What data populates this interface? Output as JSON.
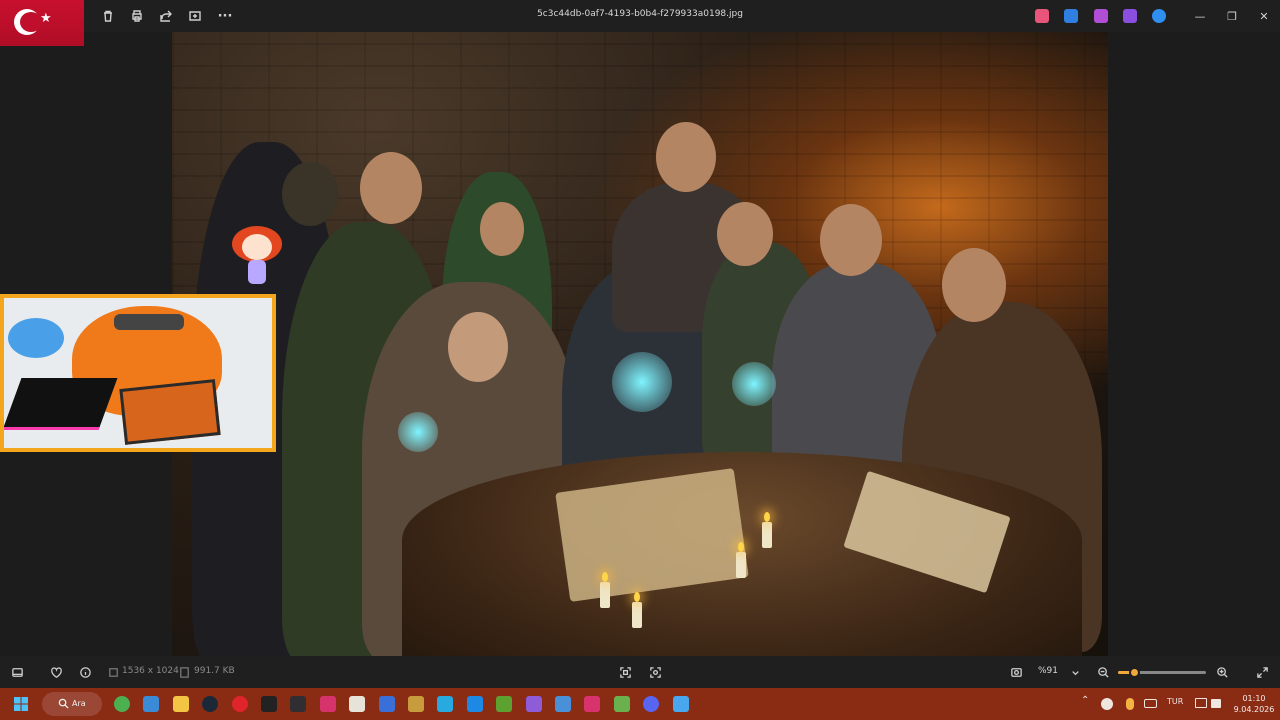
{
  "titlebar": {
    "filename": "5c3c44db-0af7-4193-b0b4-f279933a0198.jpg",
    "actions": [
      "delete-icon",
      "print-icon",
      "share-icon",
      "edit-icon",
      "more-icon"
    ],
    "more_glyph": "···",
    "app_icons": [
      {
        "name": "copilot-icon",
        "color": "#e9557a"
      },
      {
        "name": "designer-icon",
        "color": "#2f7fe0"
      },
      {
        "name": "paint-icon",
        "color": "#b04fd6"
      },
      {
        "name": "clipchamp-icon",
        "color": "#8a4ee0"
      },
      {
        "name": "onedrive-icon",
        "color": "#2f8ff0"
      }
    ],
    "minimize_glyph": "—",
    "maximize_glyph": "❐",
    "close_glyph": "✕"
  },
  "flag": {
    "star": "★"
  },
  "bottombar": {
    "dimensions": "1536 x 1024",
    "filesize": "991.7 KB",
    "zoom": "%91",
    "zoom_level": 0.18
  },
  "taskbar": {
    "search_label": "Ara",
    "language": "TUR",
    "time": "01:10",
    "date": "9.04.2026",
    "apps": [
      {
        "name": "xbox-icon",
        "color": "#4caf50"
      },
      {
        "name": "task-view-icon",
        "color": "#3a8ad6"
      },
      {
        "name": "file-explorer-icon",
        "color": "#f4c542"
      },
      {
        "name": "steam-icon",
        "color": "#1b2838"
      },
      {
        "name": "opera-icon",
        "color": "#e0242e"
      },
      {
        "name": "epic-games-icon",
        "color": "#222222"
      },
      {
        "name": "obs-icon",
        "color": "#302e31"
      },
      {
        "name": "instagram-icon",
        "color": "#d6336c"
      },
      {
        "name": "paint-net-icon",
        "color": "#e8e3d8"
      },
      {
        "name": "drawing-icon",
        "color": "#3b6fd8"
      },
      {
        "name": "league-icon",
        "color": "#c89b3c"
      },
      {
        "name": "app-blue-icon",
        "color": "#28a9e0"
      },
      {
        "name": "app-window-icon",
        "color": "#1e88e5"
      },
      {
        "name": "minecraft-icon",
        "color": "#5da130"
      },
      {
        "name": "crystal-icon",
        "color": "#8e5bd9"
      },
      {
        "name": "photo-icon",
        "color": "#4a90d9"
      },
      {
        "name": "xbox-app-icon",
        "color": "#d8336c"
      },
      {
        "name": "cube-icon",
        "color": "#6ab04c"
      },
      {
        "name": "discord-icon",
        "color": "#5865f2"
      },
      {
        "name": "photos-icon",
        "color": "#49a7f0"
      }
    ]
  }
}
